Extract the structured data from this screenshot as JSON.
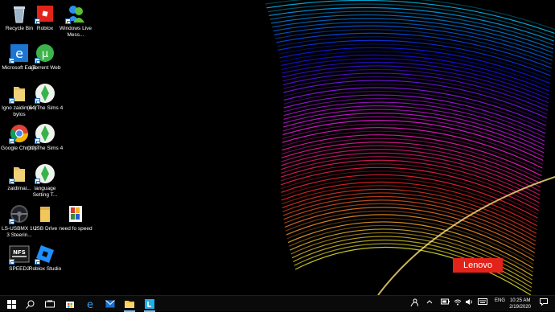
{
  "desktop": {
    "icons": [
      {
        "label": "Recycle Bin",
        "icon": "recycle-bin-icon"
      },
      {
        "label": "Roblox",
        "icon": "roblox-icon"
      },
      {
        "label": "Windows Live Mess...",
        "icon": "windows-live-messenger-icon"
      },
      {
        "label": "Microsoft Edge",
        "icon": "edge-icon"
      },
      {
        "label": "uTorrent Web",
        "icon": "utorrent-icon"
      },
      {
        "label": "Igno zaidimai ir bylos",
        "icon": "folder-icon"
      },
      {
        "label": "(64)The Sims 4",
        "icon": "sims4-icon"
      },
      {
        "label": "Google Chrome",
        "icon": "chrome-icon"
      },
      {
        "label": "(32)The Sims 4",
        "icon": "sims4-icon"
      },
      {
        "label": "zaidimai...",
        "icon": "folder-icon"
      },
      {
        "label": "language Setting T...",
        "icon": "sims4-icon"
      },
      {
        "label": "LS-USBMX 1 2 3 Steerin...",
        "icon": "steering-wheel-icon"
      },
      {
        "label": "USB Drive",
        "icon": "usb-drive-icon"
      },
      {
        "label": "need fo speed",
        "icon": "need-for-speed-icon"
      },
      {
        "label": "SPEED2",
        "icon": "nfs-icon"
      },
      {
        "label": "Roblox Studio",
        "icon": "roblox-studio-icon"
      }
    ],
    "watermark": "Lenovo"
  },
  "taskbar": {
    "pinned": [
      "windows-start-icon",
      "search-icon",
      "task-view-icon",
      "store-icon",
      "edge-icon",
      "mail-icon",
      "file-explorer-icon",
      "launcher-icon"
    ],
    "tray": {
      "language": "ENG",
      "time": "10:25 AM",
      "date": "2/19/2020"
    }
  },
  "colors": {
    "accent": "#76b9ed",
    "lenovo_red": "#e2231a",
    "taskbar": "#0a0a0a"
  }
}
